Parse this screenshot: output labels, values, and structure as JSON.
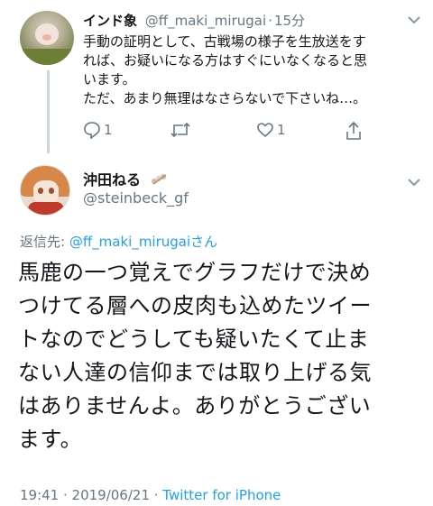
{
  "tweet1": {
    "display_name": "インド象",
    "handle": "@ff_maki_mirugai",
    "separator": "·",
    "time": "15分",
    "lines": [
      "手動の証明として、古戦場の様子を生放送をす",
      "れば、お疑いになる方はすぐにいなくなると思",
      "います。",
      "ただ、あまり無理はなさらないで下さいね…。"
    ],
    "reply_count": "1",
    "like_count": "1",
    "icons": [
      "reply-icon",
      "retweet-icon",
      "like-icon",
      "share-icon",
      "chevron-down-icon"
    ]
  },
  "tweet2": {
    "display_name": "沖田ねる",
    "handle": "@steinbeck_gf",
    "reply_to_prefix": "返信先: ",
    "reply_to_user": "@ff_maki_mirugai",
    "reply_to_suffix": "さん",
    "lines": [
      "馬鹿の一つ覚えでグラフだけで決め",
      "つけてる層への皮肉も込めたツイー",
      "トなのでどうしても疑いたくて止ま",
      "ない人達の信仰までは取り上げる気",
      "はありませんよ。ありがとうござい",
      "ます。"
    ],
    "timestamp": "19:41 · 2019/06/21 · ",
    "source": "Twitter for iPhone"
  },
  "colors": {
    "link": "#1da1f2",
    "secondary": "#657786",
    "text": "#14171a",
    "thread_line": "#ccd6dd"
  }
}
